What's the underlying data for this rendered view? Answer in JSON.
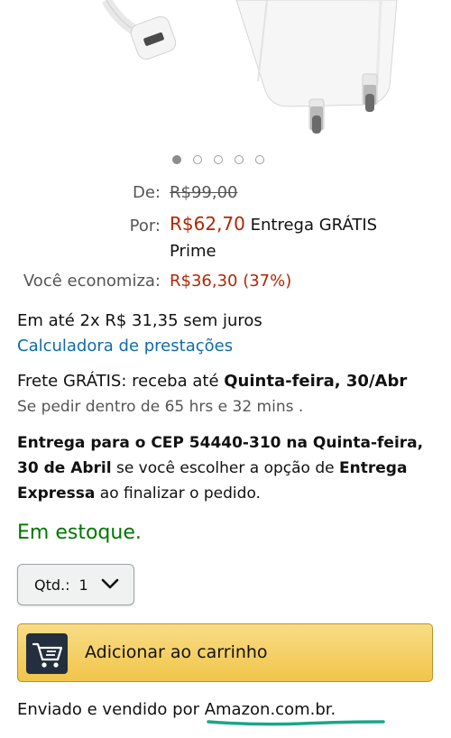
{
  "pricing": {
    "list_label": "De:",
    "list_price": "R$99,00",
    "price_label": "Por:",
    "price": "R$62,70",
    "delivery_free": "Entrega GRÁTIS",
    "prime": "Prime",
    "savings_label": "Você economiza:",
    "savings": "R$36,30 (37%)"
  },
  "installments": {
    "text": "Em até 2x R$ 31,35 sem juros",
    "calculator_link": "Calculadora de prestações"
  },
  "shipping": {
    "free_prefix": "Frete GRÁTIS: receba até ",
    "free_date": "Quinta-feira, 30/Abr",
    "order_within": "Se pedir dentro de 65 hrs e 32 mins .",
    "express_bold": "Entrega para o CEP 54440-310 na Quinta-feira,",
    "express_bold2": "30 de Abril",
    "express_mid": " se você escolher a opção de ",
    "express_bold3": "Entrega",
    "express_bold4": "Expressa",
    "express_end": " ao finalizar o pedido."
  },
  "stock": {
    "status": "Em estoque."
  },
  "quantity": {
    "label": "Qtd.:",
    "value": "1"
  },
  "cart": {
    "button_label": "Adicionar ao carrinho"
  },
  "seller": {
    "prefix": "Enviado e vendido por ",
    "name": "Amazon.com.br."
  },
  "gallery": {
    "count": 5,
    "active_index": 0
  },
  "icons": {
    "cart": "cart-icon",
    "chevron": "chevron-down-icon"
  },
  "colors": {
    "price": "#B12704",
    "link": "#0F6BA8",
    "in_stock": "#007600",
    "cart_button": "#F1C54A",
    "annotation_underline": "#1aa68a"
  }
}
